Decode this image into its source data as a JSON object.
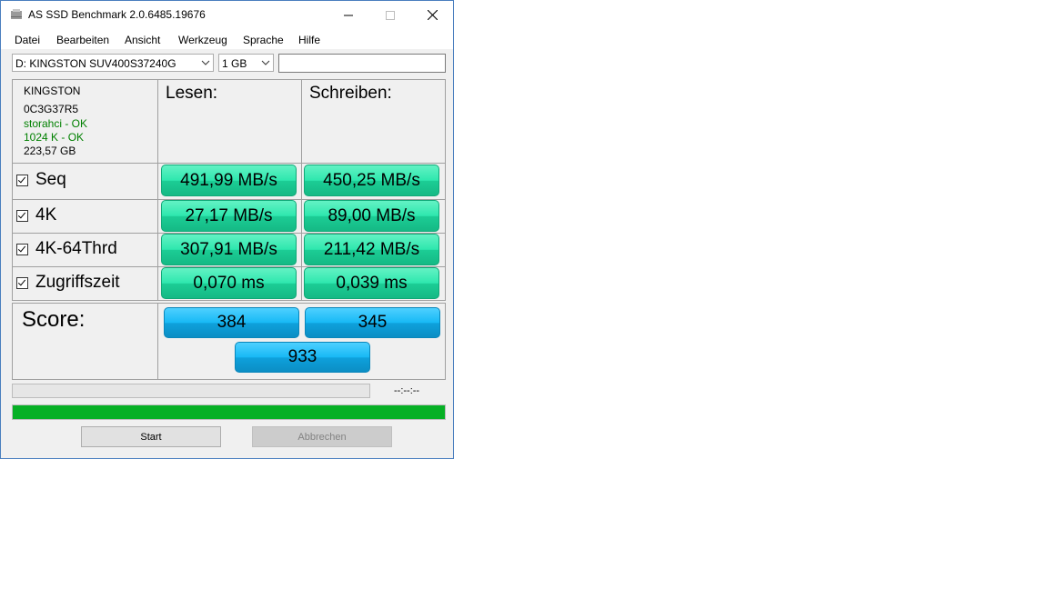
{
  "window": {
    "title": "AS SSD Benchmark 2.0.6485.19676"
  },
  "menu": [
    "Datei",
    "Bearbeiten",
    "Ansicht",
    "Werkzeug",
    "Sprache",
    "Hilfe"
  ],
  "drive_select": {
    "value": "D: KINGSTON SUV400S37240G"
  },
  "size_select": {
    "value": "1 GB"
  },
  "search_box": {
    "value": ""
  },
  "drive_info": {
    "model": "KINGSTON",
    "firmware": "0C3G37R5",
    "driver": "storahci - OK",
    "alignment": "1024 K - OK",
    "capacity": "223,57 GB"
  },
  "headers": {
    "read": "Lesen:",
    "write": "Schreiben:"
  },
  "tests": [
    {
      "label": "Seq",
      "read": "491,99 MB/s",
      "write": "450,25 MB/s"
    },
    {
      "label": "4K",
      "read": "27,17 MB/s",
      "write": "89,00 MB/s"
    },
    {
      "label": "4K-64Thrd",
      "read": "307,91 MB/s",
      "write": "211,42 MB/s"
    },
    {
      "label": "Zugriffszeit",
      "read": "0,070 ms",
      "write": "0,039 ms"
    }
  ],
  "score": {
    "label": "Score:",
    "read": "384",
    "write": "345",
    "total": "933"
  },
  "status": {
    "timer": "--:--:--",
    "progress_fraction": 1.0
  },
  "buttons": {
    "start": "Start",
    "cancel": "Abbrechen"
  },
  "colors": {
    "result_green": "#2ee7ae",
    "score_blue": "#17b9f5",
    "progress_green": "#06b025",
    "info_green": "#008000"
  }
}
